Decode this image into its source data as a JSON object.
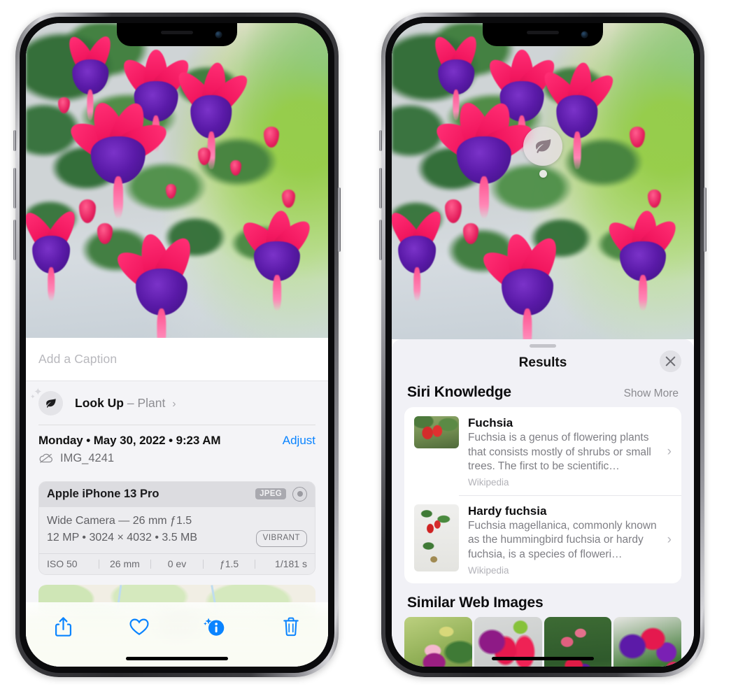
{
  "left_phone": {
    "caption": {
      "placeholder": "Add a Caption",
      "value": ""
    },
    "look_up": {
      "label": "Look Up",
      "dash": "–",
      "subject": "Plant",
      "chevron": "›",
      "icon": "leaf-icon"
    },
    "details": {
      "date": "Monday • May 30, 2022 • 9:23 AM",
      "adjust_label": "Adjust",
      "filename": "IMG_4241",
      "cloud_icon": "icloud-slash-icon"
    },
    "metadata": {
      "device": "Apple iPhone 13 Pro",
      "format_badge": "JPEG",
      "raw_icon": "aperture-icon",
      "lens_line": "Wide Camera — 26 mm ƒ1.5",
      "size_line": "12 MP • 3024 × 4032 • 3.5 MB",
      "style_badge": "VIBRANT",
      "exif": [
        "ISO 50",
        "26 mm",
        "0 ev",
        "ƒ1.5",
        "1/181 s"
      ]
    },
    "toolbar": [
      {
        "name": "share-button",
        "icon": "share-icon"
      },
      {
        "name": "favorite-button",
        "icon": "heart-icon"
      },
      {
        "name": "info-button",
        "icon": "info-sparkle-icon"
      },
      {
        "name": "delete-button",
        "icon": "trash-icon"
      }
    ]
  },
  "right_phone": {
    "visual_lookup_badge": {
      "icon": "leaf-icon"
    },
    "sheet": {
      "title": "Results",
      "close_icon": "close-icon",
      "sections": [
        {
          "title": "Siri Knowledge",
          "action": "Show More",
          "entries": [
            {
              "title": "Fuchsia",
              "description": "Fuchsia is a genus of flowering plants that consists mostly of shrubs or small trees. The first to be scientific…",
              "source": "Wikipedia",
              "chevron": "›"
            },
            {
              "title": "Hardy fuchsia",
              "description": "Fuchsia magellanica, commonly known as the hummingbird fuchsia or hardy fuchsia, is a species of floweri…",
              "source": "Wikipedia",
              "chevron": "›"
            }
          ]
        },
        {
          "title": "Similar Web Images",
          "images": [
            "fuchsia-web-image-1",
            "fuchsia-web-image-2",
            "fuchsia-web-image-3",
            "fuchsia-web-image-4"
          ]
        }
      ]
    }
  },
  "colors": {
    "accent_blue": "#0a84ff",
    "sheet_bg": "#f1f1f6",
    "card_bg": "#ffffff",
    "secondary_text": "#8e8e93",
    "meta_header_bg": "#dcdce0"
  }
}
